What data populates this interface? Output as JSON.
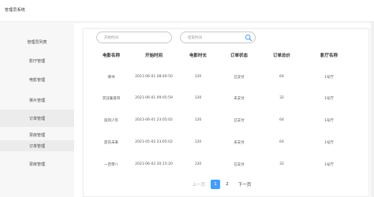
{
  "app": {
    "title": "管理员系统"
  },
  "sidebar": {
    "items": [
      {
        "label": "管理员列表"
      },
      {
        "label": "影厅管理"
      },
      {
        "label": "电影管理"
      },
      {
        "label": "排片管理"
      },
      {
        "label": "订单管理"
      },
      {
        "label": "票房管理"
      },
      {
        "label": "订单管理"
      },
      {
        "label": "票房管理"
      }
    ]
  },
  "filters": {
    "start_placeholder": "开始时间",
    "end_placeholder": "结束时间"
  },
  "table": {
    "headers": [
      "电影名称",
      "开始时间",
      "电影时长",
      "订单状态",
      "订单总价",
      "影厅名称"
    ],
    "rows": [
      [
        "倩书",
        "2021-06-01 08:46:50",
        "120",
        "已支付",
        "64",
        "1号厅"
      ],
      [
        "衣冠禽兽哥",
        "2021-06-01 09:05:59",
        "120",
        "未支付",
        "32",
        "1号厅"
      ],
      [
        "旋风少年",
        "2021-06-01 23:05:02",
        "120",
        "已支付",
        "64",
        "1号厅"
      ],
      [
        "庞氏未来",
        "2021-05-02 23:05:02",
        "120",
        "未支付",
        "64",
        "1号厅"
      ],
      [
        "一百零八",
        "2021-06-02 20:15:20",
        "120",
        "已支付",
        "32",
        "1号厅"
      ]
    ]
  },
  "pagination": {
    "prev_label": "上一页",
    "pages": [
      "1",
      "2"
    ],
    "next_label": "下一页",
    "current": "1"
  }
}
